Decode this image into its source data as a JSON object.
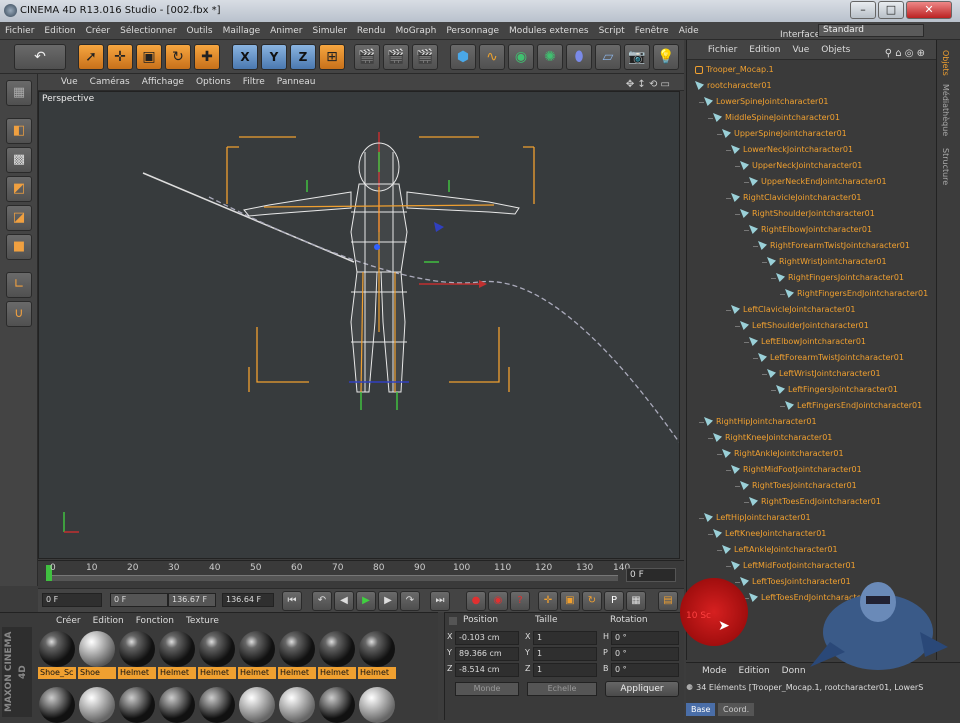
{
  "window": {
    "title": "CINEMA 4D R13.016 Studio - [002.fbx *]",
    "buttons": {
      "minimize": "–",
      "maximize": "□",
      "close": "✕"
    }
  },
  "menubar": {
    "items": [
      "Fichier",
      "Edition",
      "Créer",
      "Sélectionner",
      "Outils",
      "Maillage",
      "Animer",
      "Simuler",
      "Rendu",
      "MoGraph",
      "Personnage",
      "Modules externes",
      "Script",
      "Fenêtre",
      "Aide"
    ],
    "interface_label": "Interface:",
    "interface_value": "Standard"
  },
  "toolbar": {
    "undo_icon": "↶",
    "axis_x": "X",
    "axis_y": "Y",
    "axis_z": "Z"
  },
  "viewport": {
    "menu": [
      "Vue",
      "Caméras",
      "Affichage",
      "Options",
      "Filtre",
      "Panneau"
    ],
    "label": "Perspective"
  },
  "timeline": {
    "ticks": [
      "0",
      "10",
      "20",
      "30",
      "40",
      "50",
      "60",
      "70",
      "80",
      "90",
      "100",
      "110",
      "120",
      "130",
      "140"
    ],
    "current_frame": "0 F"
  },
  "transport": {
    "start_field": "0 F",
    "min_field": "0 F",
    "max_field": "136.67 F",
    "end_field": "136.64 F"
  },
  "materials": {
    "menu": [
      "Créer",
      "Edition",
      "Fonction",
      "Texture"
    ],
    "brand": "MAXON CINEMA 4D",
    "items": [
      {
        "label": "Shoe_Sc",
        "style": "dark"
      },
      {
        "label": "Shoe",
        "style": "white"
      },
      {
        "label": "Helmet",
        "style": "dark"
      },
      {
        "label": "Helmet",
        "style": "dark"
      },
      {
        "label": "Helmet",
        "style": "dark"
      },
      {
        "label": "Helmet",
        "style": "dark"
      },
      {
        "label": "Helmet",
        "style": "dark"
      },
      {
        "label": "Helmet",
        "style": "dark"
      },
      {
        "label": "Helmet",
        "style": "dark"
      }
    ]
  },
  "coords": {
    "headers": {
      "position": "Position",
      "size": "Taille",
      "rotation": "Rotation"
    },
    "rows": [
      {
        "axis": "X",
        "pos": "-0.103 cm",
        "size_axis": "X",
        "size": "1",
        "rot_axis": "H",
        "rot": "0 °"
      },
      {
        "axis": "Y",
        "pos": "89.366 cm",
        "size_axis": "Y",
        "size": "1",
        "rot_axis": "P",
        "rot": "0 °"
      },
      {
        "axis": "Z",
        "pos": "-8.514 cm",
        "size_axis": "Z",
        "size": "1",
        "rot_axis": "B",
        "rot": "0 °"
      }
    ],
    "mode_left": "Monde",
    "mode_mid": "Echelle",
    "apply": "Appliquer"
  },
  "objects": {
    "menu": [
      "Fichier",
      "Edition",
      "Vue",
      "Objets"
    ],
    "tree": [
      {
        "label": "Trooper_Mocap.1",
        "depth": 0,
        "null": true
      },
      {
        "label": "rootcharacter01",
        "depth": 0
      },
      {
        "label": "LowerSpineJointcharacter01",
        "depth": 1
      },
      {
        "label": "MiddleSpineJointcharacter01",
        "depth": 2
      },
      {
        "label": "UpperSpineJointcharacter01",
        "depth": 3
      },
      {
        "label": "LowerNeckJointcharacter01",
        "depth": 4
      },
      {
        "label": "UpperNeckJointcharacter01",
        "depth": 5
      },
      {
        "label": "UpperNeckEndJointcharacter01",
        "depth": 6
      },
      {
        "label": "RightClavicleJointcharacter01",
        "depth": 4
      },
      {
        "label": "RightShoulderJointcharacter01",
        "depth": 5
      },
      {
        "label": "RightElbowJointcharacter01",
        "depth": 6
      },
      {
        "label": "RightForearmTwistJointcharacter01",
        "depth": 7
      },
      {
        "label": "RightWristJointcharacter01",
        "depth": 8
      },
      {
        "label": "RightFingersJointcharacter01",
        "depth": 9
      },
      {
        "label": "RightFingersEndJointcharacter01",
        "depth": 10
      },
      {
        "label": "LeftClavicleJointcharacter01",
        "depth": 4
      },
      {
        "label": "LeftShoulderJointcharacter01",
        "depth": 5
      },
      {
        "label": "LeftElbowJointcharacter01",
        "depth": 6
      },
      {
        "label": "LeftForearmTwistJointcharacter01",
        "depth": 7
      },
      {
        "label": "LeftWristJointcharacter01",
        "depth": 8
      },
      {
        "label": "LeftFingersJointcharacter01",
        "depth": 9
      },
      {
        "label": "LeftFingersEndJointcharacter01",
        "depth": 10
      },
      {
        "label": "RightHipJointcharacter01",
        "depth": 1
      },
      {
        "label": "RightKneeJointcharacter01",
        "depth": 2
      },
      {
        "label": "RightAnkleJointcharacter01",
        "depth": 3
      },
      {
        "label": "RightMidFootJointcharacter01",
        "depth": 4
      },
      {
        "label": "RightToesJointcharacter01",
        "depth": 5
      },
      {
        "label": "RightToesEndJointcharacter01",
        "depth": 6
      },
      {
        "label": "LeftHipJointcharacter01",
        "depth": 1
      },
      {
        "label": "LeftKneeJointcharacter01",
        "depth": 2
      },
      {
        "label": "LeftAnkleJointcharacter01",
        "depth": 3
      },
      {
        "label": "LeftMidFootJointcharacter01",
        "depth": 4
      },
      {
        "label": "LeftToesJointcharacter01",
        "depth": 5
      },
      {
        "label": "LeftToesEndJointcharacter01",
        "depth": 6
      }
    ],
    "side_tabs": [
      "Objets",
      "Médiathèque",
      "Structure"
    ]
  },
  "attributes": {
    "menu": [
      "Mode",
      "Edition",
      "Donn"
    ],
    "status": "34 Eléments [Trooper_Mocap.1, rootcharacter01, LowerS",
    "tabs": [
      "Base",
      "Coord."
    ]
  },
  "overlay": {
    "record_text": "10 Sc"
  },
  "colors": {
    "accent": "#f0a030",
    "panel": "#3a3a3a",
    "viewport": "#373b3d"
  }
}
